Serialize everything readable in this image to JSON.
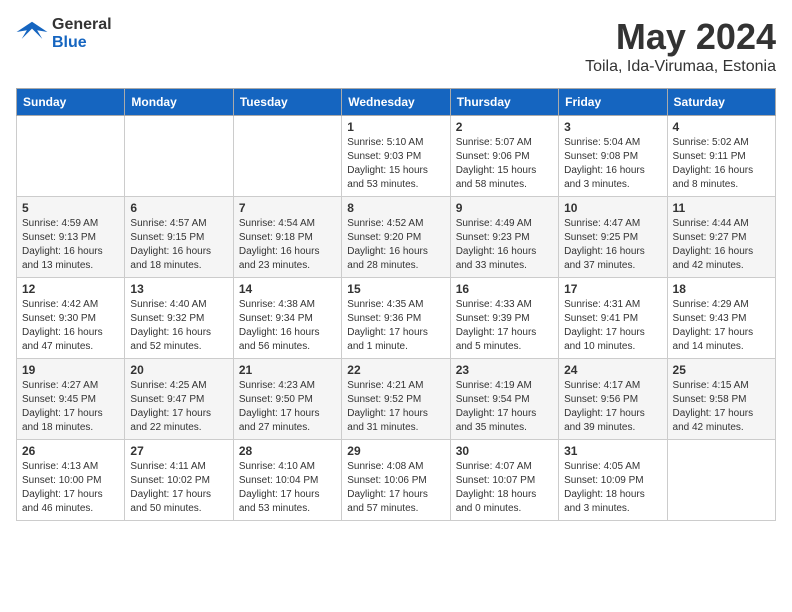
{
  "header": {
    "logo_general": "General",
    "logo_blue": "Blue",
    "title": "May 2024",
    "subtitle": "Toila, Ida-Virumaa, Estonia"
  },
  "calendar": {
    "headers": [
      "Sunday",
      "Monday",
      "Tuesday",
      "Wednesday",
      "Thursday",
      "Friday",
      "Saturday"
    ],
    "weeks": [
      [
        {
          "day": "",
          "info": ""
        },
        {
          "day": "",
          "info": ""
        },
        {
          "day": "",
          "info": ""
        },
        {
          "day": "1",
          "info": "Sunrise: 5:10 AM\nSunset: 9:03 PM\nDaylight: 15 hours\nand 53 minutes."
        },
        {
          "day": "2",
          "info": "Sunrise: 5:07 AM\nSunset: 9:06 PM\nDaylight: 15 hours\nand 58 minutes."
        },
        {
          "day": "3",
          "info": "Sunrise: 5:04 AM\nSunset: 9:08 PM\nDaylight: 16 hours\nand 3 minutes."
        },
        {
          "day": "4",
          "info": "Sunrise: 5:02 AM\nSunset: 9:11 PM\nDaylight: 16 hours\nand 8 minutes."
        }
      ],
      [
        {
          "day": "5",
          "info": "Sunrise: 4:59 AM\nSunset: 9:13 PM\nDaylight: 16 hours\nand 13 minutes."
        },
        {
          "day": "6",
          "info": "Sunrise: 4:57 AM\nSunset: 9:15 PM\nDaylight: 16 hours\nand 18 minutes."
        },
        {
          "day": "7",
          "info": "Sunrise: 4:54 AM\nSunset: 9:18 PM\nDaylight: 16 hours\nand 23 minutes."
        },
        {
          "day": "8",
          "info": "Sunrise: 4:52 AM\nSunset: 9:20 PM\nDaylight: 16 hours\nand 28 minutes."
        },
        {
          "day": "9",
          "info": "Sunrise: 4:49 AM\nSunset: 9:23 PM\nDaylight: 16 hours\nand 33 minutes."
        },
        {
          "day": "10",
          "info": "Sunrise: 4:47 AM\nSunset: 9:25 PM\nDaylight: 16 hours\nand 37 minutes."
        },
        {
          "day": "11",
          "info": "Sunrise: 4:44 AM\nSunset: 9:27 PM\nDaylight: 16 hours\nand 42 minutes."
        }
      ],
      [
        {
          "day": "12",
          "info": "Sunrise: 4:42 AM\nSunset: 9:30 PM\nDaylight: 16 hours\nand 47 minutes."
        },
        {
          "day": "13",
          "info": "Sunrise: 4:40 AM\nSunset: 9:32 PM\nDaylight: 16 hours\nand 52 minutes."
        },
        {
          "day": "14",
          "info": "Sunrise: 4:38 AM\nSunset: 9:34 PM\nDaylight: 16 hours\nand 56 minutes."
        },
        {
          "day": "15",
          "info": "Sunrise: 4:35 AM\nSunset: 9:36 PM\nDaylight: 17 hours\nand 1 minute."
        },
        {
          "day": "16",
          "info": "Sunrise: 4:33 AM\nSunset: 9:39 PM\nDaylight: 17 hours\nand 5 minutes."
        },
        {
          "day": "17",
          "info": "Sunrise: 4:31 AM\nSunset: 9:41 PM\nDaylight: 17 hours\nand 10 minutes."
        },
        {
          "day": "18",
          "info": "Sunrise: 4:29 AM\nSunset: 9:43 PM\nDaylight: 17 hours\nand 14 minutes."
        }
      ],
      [
        {
          "day": "19",
          "info": "Sunrise: 4:27 AM\nSunset: 9:45 PM\nDaylight: 17 hours\nand 18 minutes."
        },
        {
          "day": "20",
          "info": "Sunrise: 4:25 AM\nSunset: 9:47 PM\nDaylight: 17 hours\nand 22 minutes."
        },
        {
          "day": "21",
          "info": "Sunrise: 4:23 AM\nSunset: 9:50 PM\nDaylight: 17 hours\nand 27 minutes."
        },
        {
          "day": "22",
          "info": "Sunrise: 4:21 AM\nSunset: 9:52 PM\nDaylight: 17 hours\nand 31 minutes."
        },
        {
          "day": "23",
          "info": "Sunrise: 4:19 AM\nSunset: 9:54 PM\nDaylight: 17 hours\nand 35 minutes."
        },
        {
          "day": "24",
          "info": "Sunrise: 4:17 AM\nSunset: 9:56 PM\nDaylight: 17 hours\nand 39 minutes."
        },
        {
          "day": "25",
          "info": "Sunrise: 4:15 AM\nSunset: 9:58 PM\nDaylight: 17 hours\nand 42 minutes."
        }
      ],
      [
        {
          "day": "26",
          "info": "Sunrise: 4:13 AM\nSunset: 10:00 PM\nDaylight: 17 hours\nand 46 minutes."
        },
        {
          "day": "27",
          "info": "Sunrise: 4:11 AM\nSunset: 10:02 PM\nDaylight: 17 hours\nand 50 minutes."
        },
        {
          "day": "28",
          "info": "Sunrise: 4:10 AM\nSunset: 10:04 PM\nDaylight: 17 hours\nand 53 minutes."
        },
        {
          "day": "29",
          "info": "Sunrise: 4:08 AM\nSunset: 10:06 PM\nDaylight: 17 hours\nand 57 minutes."
        },
        {
          "day": "30",
          "info": "Sunrise: 4:07 AM\nSunset: 10:07 PM\nDaylight: 18 hours\nand 0 minutes."
        },
        {
          "day": "31",
          "info": "Sunrise: 4:05 AM\nSunset: 10:09 PM\nDaylight: 18 hours\nand 3 minutes."
        },
        {
          "day": "",
          "info": ""
        }
      ]
    ]
  }
}
